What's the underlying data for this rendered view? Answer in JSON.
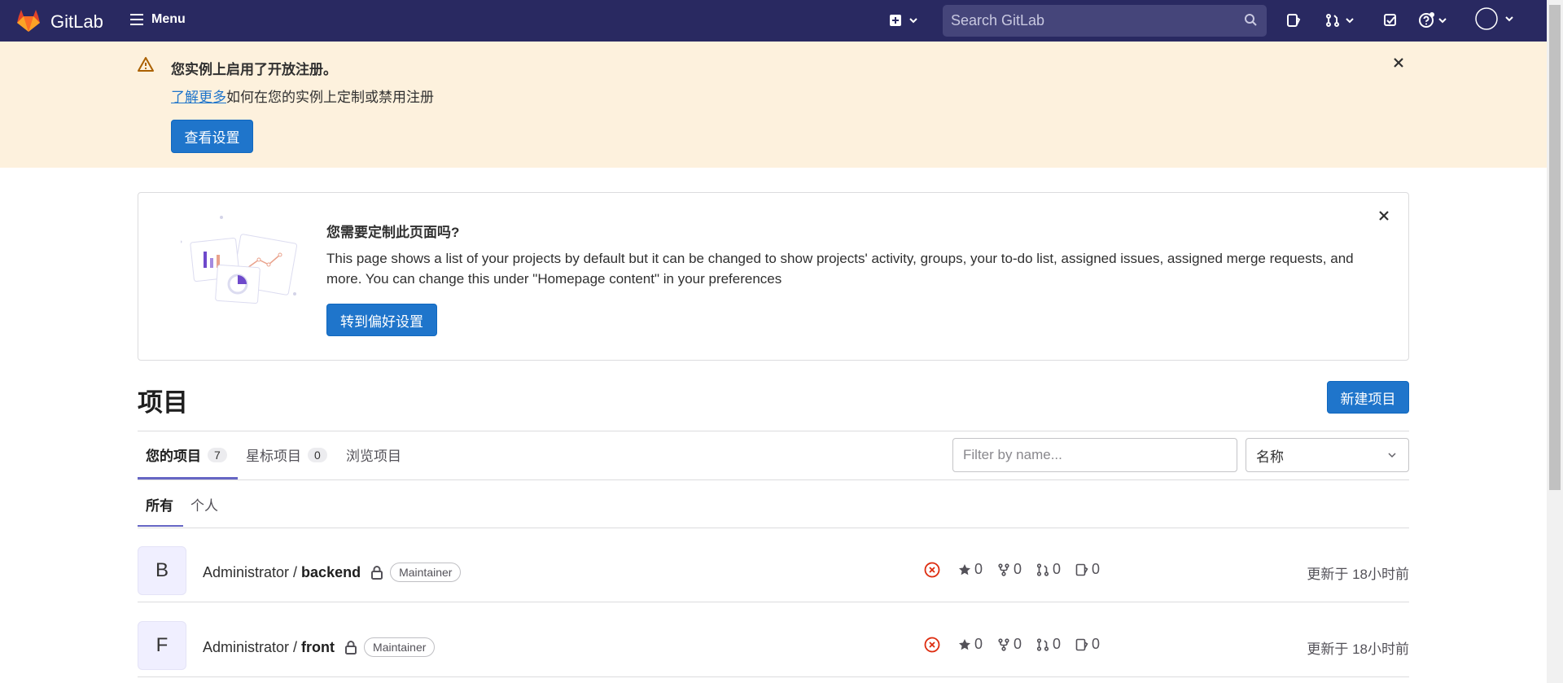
{
  "navbar": {
    "brand": "GitLab",
    "menu_label": "Menu",
    "search_placeholder": "Search GitLab"
  },
  "banner": {
    "title": "您实例上启用了开放注册。",
    "link_text": "了解更多",
    "text_rest": "如何在您的实例上定制或禁用注册",
    "button_label": "查看设置"
  },
  "customize_card": {
    "title": "您需要定制此页面吗?",
    "text": "This page shows a list of your projects by default but it can be changed to show projects' activity, groups, your to-do list, assigned issues, assigned merge requests, and more. You can change this under \"Homepage content\" in your preferences",
    "button_label": "转到偏好设置"
  },
  "projects": {
    "title": "项目",
    "new_button": "新建项目",
    "tabs": [
      {
        "label": "您的项目",
        "count": "7"
      },
      {
        "label": "星标项目",
        "count": "0"
      },
      {
        "label": "浏览项目"
      }
    ],
    "filter_placeholder": "Filter by name...",
    "sort_value": "名称",
    "subtabs": [
      {
        "label": "所有"
      },
      {
        "label": "个人"
      }
    ],
    "rows": [
      {
        "avatar": "B",
        "namespace": "Administrator /",
        "name": "backend",
        "role": "Maintainer",
        "stars": "0",
        "forks": "0",
        "merge_requests": "0",
        "issues": "0",
        "updated": "更新于 18小时前"
      },
      {
        "avatar": "F",
        "namespace": "Administrator /",
        "name": "front",
        "role": "Maintainer",
        "stars": "0",
        "forks": "0",
        "merge_requests": "0",
        "issues": "0",
        "updated": "更新于 18小时前"
      }
    ]
  },
  "colors": {
    "navbar_bg": "#292961",
    "banner_bg": "#fdf1dd",
    "primary": "#1f75cb",
    "pipeline_failed": "#dd2b0e"
  }
}
